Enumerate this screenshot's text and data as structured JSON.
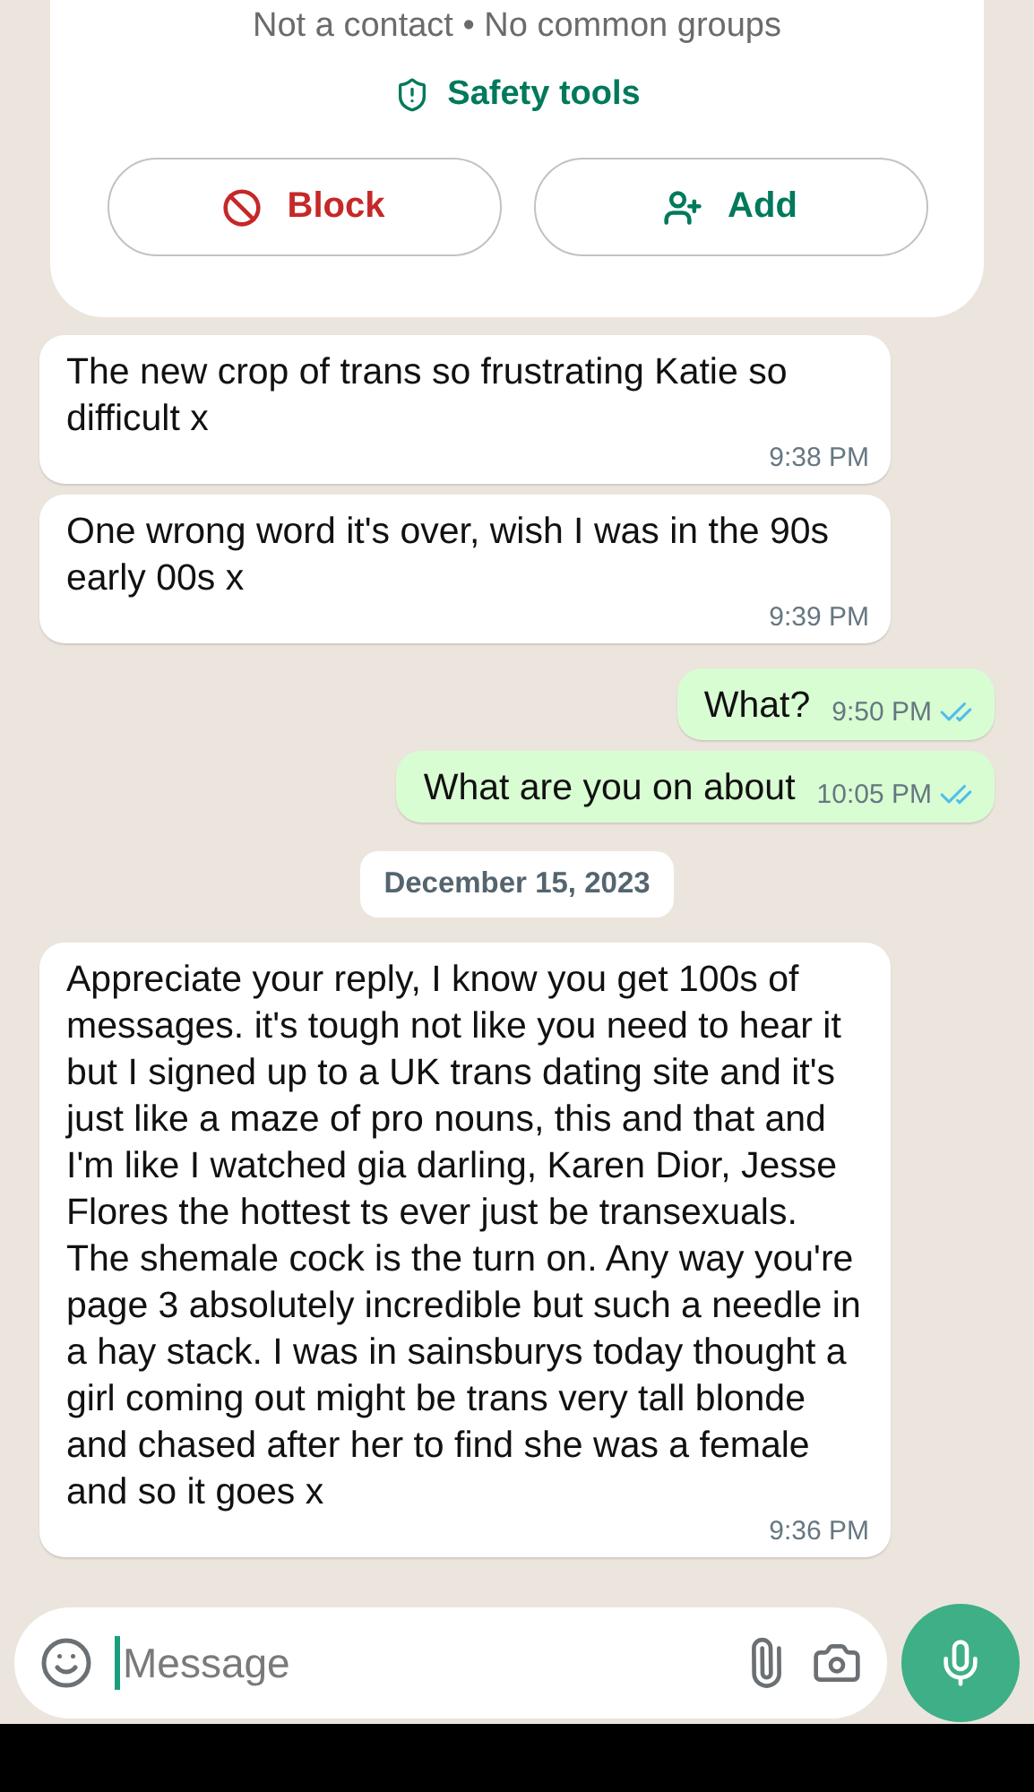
{
  "header": {
    "info": "Not a contact • No common groups",
    "safety_link": "Safety tools",
    "buttons": [
      {
        "label": "Block",
        "kind": "block"
      },
      {
        "label": "Add",
        "kind": "add"
      }
    ]
  },
  "messages": [
    {
      "kind": "incoming",
      "text": "The new crop of trans so frustrating Katie so difficult x",
      "time": "9:38 PM"
    },
    {
      "kind": "incoming",
      "text": "One wrong word it's over, wish I was in the 90s early 00s x",
      "time": "9:39 PM"
    },
    {
      "kind": "outgoing",
      "text": "What?",
      "time": "9:50 PM",
      "read": true
    },
    {
      "kind": "outgoing",
      "text": "What are you on about",
      "time": "10:05 PM",
      "read": true
    },
    {
      "kind": "date",
      "text": "December 15, 2023"
    },
    {
      "kind": "incoming",
      "text": "Appreciate your reply, I know you get 100s of messages.  it's tough not like you need to hear it but I signed up to a UK trans dating site and it's just like a maze of pro nouns, this and that and I'm like I watched gia darling, Karen Dior, Jesse Flores the hottest ts ever just be transexuals. The shemale cock is the turn on. Any way you're page 3 absolutely incredible but such a needle in a hay stack. I was in sainsburys today thought a girl coming out might be trans very tall blonde and chased after her to find she was a female and so it goes x",
      "time": "9:36 PM"
    }
  ],
  "composer": {
    "placeholder": "Message"
  }
}
